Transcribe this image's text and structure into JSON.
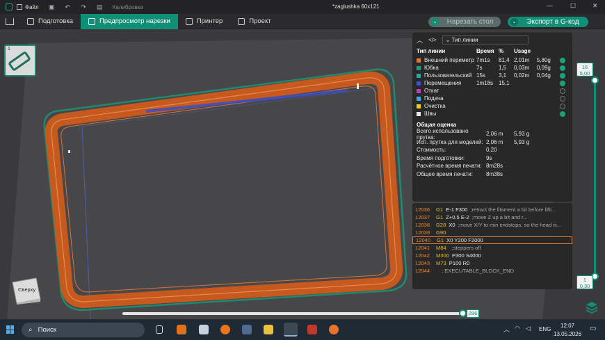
{
  "titlebar": {
    "file_label": "Файл",
    "calibration_label": "Калибровка",
    "document_title": "*zaglushka 60x121"
  },
  "tabs": [
    "Подготовка",
    "Предпросмотр нарезки",
    "Принтер",
    "Проект"
  ],
  "actions": {
    "slice_label": "Нарезать стол",
    "export_label": "Экспорт в G-код"
  },
  "plate": {
    "number": "1"
  },
  "legend": {
    "view_selector": "Тип линии",
    "headers": {
      "type": "Тип линии",
      "time": "Время",
      "percent": "%",
      "usage": "Usage"
    },
    "rows": [
      {
        "name": "Внешний периметр",
        "time": "7m1s",
        "percent": "81,4",
        "length": "2,01m",
        "weight": "5,80g",
        "color": "#e8732c"
      },
      {
        "name": "Юбка",
        "time": "7s",
        "percent": "1,5",
        "length": "0,03m",
        "weight": "0,09g",
        "color": "#1aa37a"
      },
      {
        "name": "Пользовательский",
        "time": "15s",
        "percent": "3,1",
        "length": "0,02m",
        "weight": "0,04g",
        "color": "#1fae9a"
      },
      {
        "name": "Перемещения",
        "time": "1m18s",
        "percent": "15,1",
        "length": "",
        "weight": "",
        "color": "#3a4ec8"
      },
      {
        "name": "Откат",
        "time": "",
        "percent": "",
        "length": "",
        "weight": "",
        "color": "#c23ac4"
      },
      {
        "name": "Подача",
        "time": "",
        "percent": "",
        "length": "",
        "weight": "",
        "color": "#3aa8e0"
      },
      {
        "name": "Очистка",
        "time": "",
        "percent": "",
        "length": "",
        "weight": "",
        "color": "#e8d21c"
      },
      {
        "name": "Швы",
        "time": "",
        "percent": "",
        "length": "",
        "weight": "",
        "color": "#e8e8e8"
      }
    ]
  },
  "summary": {
    "title": "Общая оценка",
    "rows": [
      {
        "label": "Всего использовано прутка:",
        "v1": "2,06 m",
        "v2": "5,93 g"
      },
      {
        "label": "Исп. прутка для моделей:",
        "v1": "2,06 m",
        "v2": "5,93 g"
      },
      {
        "label": "Стоимость:",
        "v1": "0,20",
        "v2": ""
      },
      {
        "label": "Время подготовки:",
        "v1": "9s",
        "v2": ""
      },
      {
        "label": "Расчётное время печати:",
        "v1": "8m28s",
        "v2": ""
      },
      {
        "label": "Общее время печати:",
        "v1": "8m38s",
        "v2": ""
      }
    ]
  },
  "gcode": [
    {
      "num": "12036",
      "cmd": "G1",
      "params": "E-1 F300",
      "comment": ";retract the filament a bit before lifti..."
    },
    {
      "num": "12037",
      "cmd": "G1",
      "params": "Z+0.5 E-2",
      "comment": ";move Z up a bit and r..."
    },
    {
      "num": "12038",
      "cmd": "G28",
      "params": "X0",
      "comment": ";move X/Y to min endstops, so the head is..."
    },
    {
      "num": "12039",
      "cmd": "G90",
      "params": "",
      "comment": ""
    },
    {
      "num": "12040",
      "cmd": "G1",
      "params": "X0 Y200 F2000",
      "comment": ""
    },
    {
      "num": "12041",
      "cmd": "M84",
      "params": "",
      "comment": ";steppers off"
    },
    {
      "num": "12042",
      "cmd": "M300",
      "params": "P300 S4000",
      "comment": ""
    },
    {
      "num": "12043",
      "cmd": "M73",
      "params": "P100 R0",
      "comment": ""
    },
    {
      "num": "12044",
      "cmd": "",
      "params": "",
      "comment": "; EXECUTABLE_BLOCK_END"
    }
  ],
  "layer_slider": {
    "top_layer": "16",
    "top_height": "5,00",
    "bottom_layer": "1",
    "bottom_height": "0,30"
  },
  "move_slider": {
    "value": "296"
  },
  "view_cube": {
    "label": "Сверху"
  },
  "taskbar": {
    "search_placeholder": "Поиск",
    "language": "ENG",
    "time": "12:07",
    "date": "13.05.2026"
  }
}
